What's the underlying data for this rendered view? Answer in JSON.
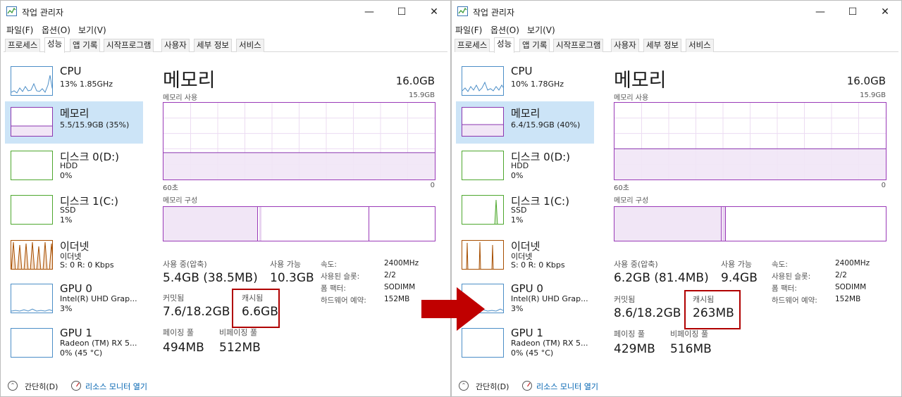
{
  "arrow_color": "#c00000",
  "windows": [
    {
      "id": "before",
      "title": "작업 관리자",
      "menu": [
        "파일(F)",
        "옵션(O)",
        "보기(V)"
      ],
      "tabs": [
        "프로세스",
        "성능",
        "앱 기록",
        "시작프로그램",
        "사용자",
        "세부 정보",
        "서비스"
      ],
      "active_tab": "성능",
      "sidebar": [
        {
          "name": "CPU",
          "line1": "13% 1.85GHz",
          "line2": ""
        },
        {
          "name": "메모리",
          "line1": "5.5/15.9GB (35%)",
          "line2": ""
        },
        {
          "name": "디스크 0(D:)",
          "line1": "HDD",
          "line2": "0%"
        },
        {
          "name": "디스크 1(C:)",
          "line1": "SSD",
          "line2": "1%"
        },
        {
          "name": "이더넷",
          "line1": "이더넷",
          "line2": "S: 0 R: 0 Kbps"
        },
        {
          "name": "GPU 0",
          "line1": "Intel(R) UHD Grap...",
          "line2": "3%"
        },
        {
          "name": "GPU 1",
          "line1": "Radeon (TM) RX 5...",
          "line2": "0% (45 °C)"
        }
      ],
      "main": {
        "title": "메모리",
        "total": "16.0GB",
        "usage_label": "메모리 사용",
        "usage_max": "15.9GB",
        "axis_left": "60초",
        "axis_right": "0",
        "composition_label": "메모리 구성",
        "in_use_label": "사용 중(압축)",
        "in_use": "5.4GB (38.5MB)",
        "available_label": "사용 가능",
        "available": "10.3GB",
        "committed_label": "커밋됨",
        "committed": "7.6/18.2GB",
        "cached_label": "캐시됨",
        "cached": "6.6GB",
        "paged_label": "페이징 풀",
        "paged": "494MB",
        "nonpaged_label": "비페이징 풀",
        "nonpaged": "512MB",
        "speed_label": "속도:",
        "speed": "2400MHz",
        "slots_label": "사용된 슬롯:",
        "slots": "2/2",
        "form_label": "폼 팩터:",
        "form": "SODIMM",
        "reserved_label": "하드웨어 예약:",
        "reserved": "152MB",
        "usage_fraction": 0.35
      },
      "footer": {
        "brief": "간단히(D)",
        "resource_monitor": "리소스 모니터 열기"
      }
    },
    {
      "id": "after",
      "title": "작업 관리자",
      "menu": [
        "파일(F)",
        "옵션(O)",
        "보기(V)"
      ],
      "tabs": [
        "프로세스",
        "성능",
        "앱 기록",
        "시작프로그램",
        "사용자",
        "세부 정보",
        "서비스"
      ],
      "active_tab": "성능",
      "sidebar": [
        {
          "name": "CPU",
          "line1": "10% 1.78GHz",
          "line2": ""
        },
        {
          "name": "메모리",
          "line1": "6.4/15.9GB (40%)",
          "line2": ""
        },
        {
          "name": "디스크 0(D:)",
          "line1": "HDD",
          "line2": "0%"
        },
        {
          "name": "디스크 1(C:)",
          "line1": "SSD",
          "line2": "1%"
        },
        {
          "name": "이더넷",
          "line1": "이더넷",
          "line2": "S: 0 R: 0 Kbps"
        },
        {
          "name": "GPU 0",
          "line1": "Intel(R) UHD Grap...",
          "line2": "3%"
        },
        {
          "name": "GPU 1",
          "line1": "Radeon (TM) RX 5...",
          "line2": "0% (45 °C)"
        }
      ],
      "main": {
        "title": "메모리",
        "total": "16.0GB",
        "usage_label": "메모리 사용",
        "usage_max": "15.9GB",
        "axis_left": "60초",
        "axis_right": "0",
        "composition_label": "메모리 구성",
        "in_use_label": "사용 중(압축)",
        "in_use": "6.2GB (81.4MB)",
        "available_label": "사용 가능",
        "available": "9.4GB",
        "committed_label": "커밋됨",
        "committed": "8.6/18.2GB",
        "cached_label": "캐시됨",
        "cached": "263MB",
        "paged_label": "페이징 풀",
        "paged": "429MB",
        "nonpaged_label": "비페이징 풀",
        "nonpaged": "516MB",
        "speed_label": "속도:",
        "speed": "2400MHz",
        "slots_label": "사용된 슬롯:",
        "slots": "2/2",
        "form_label": "폼 팩터:",
        "form": "SODIMM",
        "reserved_label": "하드웨어 예약:",
        "reserved": "152MB",
        "usage_fraction": 0.4
      },
      "footer": {
        "brief": "간단히(D)",
        "resource_monitor": "리소스 모니터 열기"
      }
    }
  ]
}
